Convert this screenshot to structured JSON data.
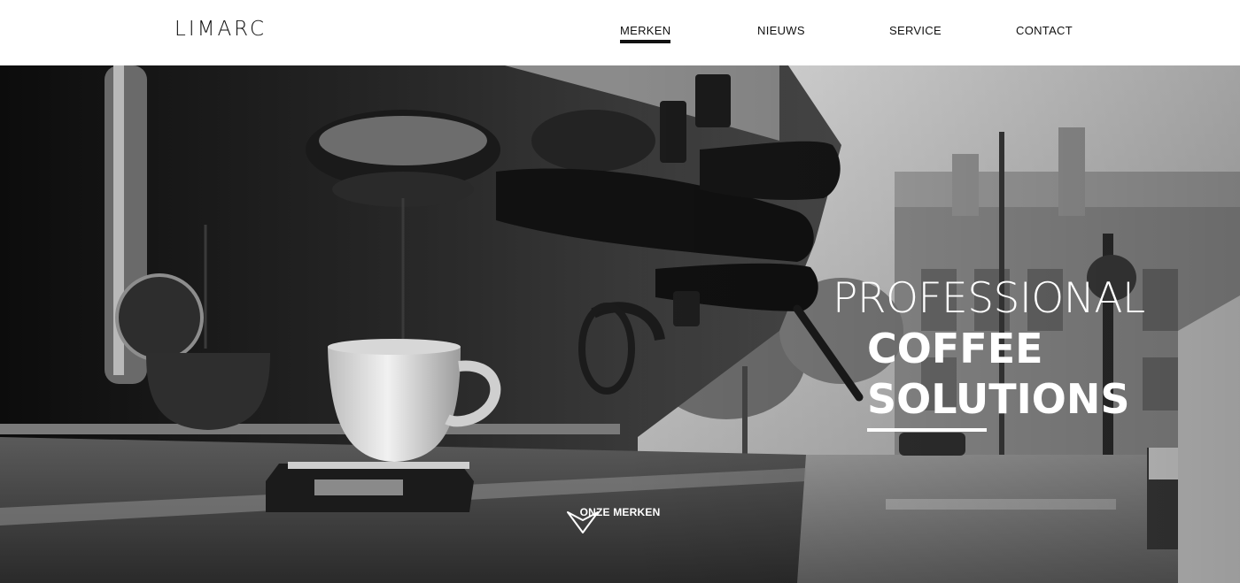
{
  "brand": {
    "logo_text": "LIMARC"
  },
  "nav": {
    "items": [
      {
        "label": "MERKEN",
        "active": true
      },
      {
        "label": "NIEUWS",
        "active": false
      },
      {
        "label": "SERVICE",
        "active": false
      },
      {
        "label": "CONTACT",
        "active": false
      }
    ]
  },
  "hero": {
    "image_description": "black-and-white espresso machine with cup in front of rainy street",
    "headline": {
      "line1": "PROFESSIONAL",
      "line2": "COFFEE",
      "line3": "SOLUTIONS"
    },
    "cta": {
      "label": "ONZE MERKEN",
      "icon": "chevron-down-icon"
    }
  },
  "colors": {
    "header_bg": "#ffffff",
    "text_dark": "#111111",
    "hero_text": "#ffffff"
  }
}
